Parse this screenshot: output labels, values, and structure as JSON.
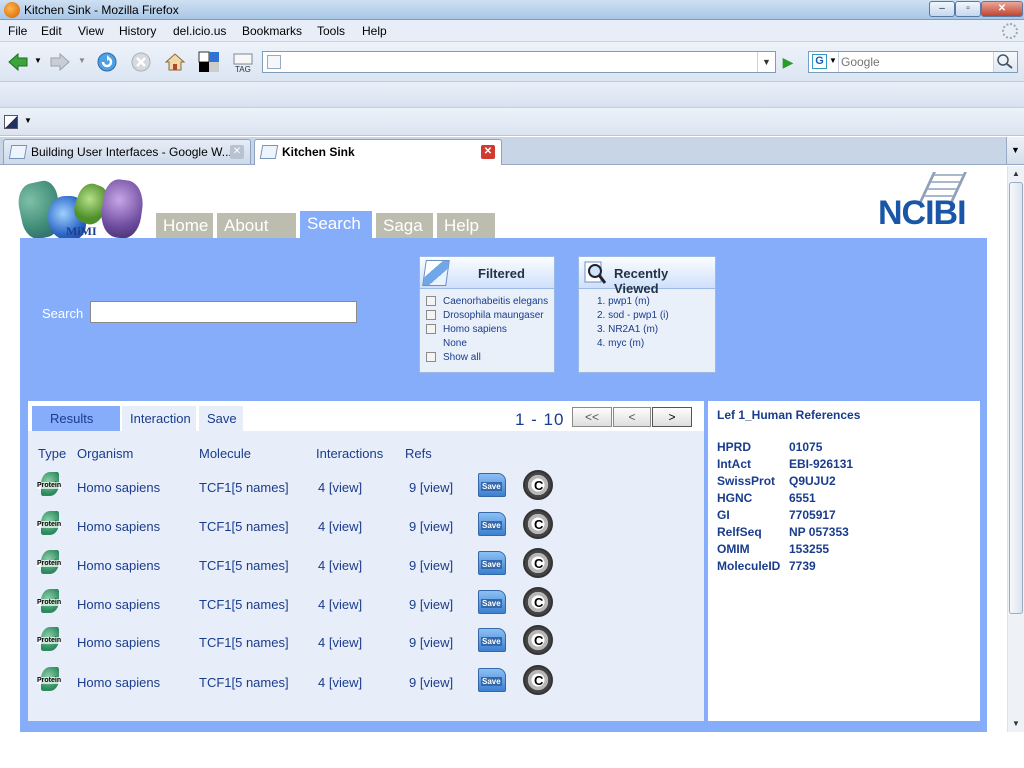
{
  "browser": {
    "window_title": "Kitchen Sink - Mozilla Firefox",
    "menu": [
      "File",
      "Edit",
      "View",
      "History",
      "del.icio.us",
      "Bookmarks",
      "Tools",
      "Help"
    ],
    "url": "",
    "search_engine_placeholder": "Google",
    "tabs": [
      {
        "label": "Building User Interfaces - Google W...",
        "active": false
      },
      {
        "label": "Kitchen Sink",
        "active": true
      }
    ],
    "nav_icons": [
      "back-icon",
      "forward-icon",
      "reload-icon",
      "stop-icon",
      "home-icon",
      "delicious-icon",
      "tag-icon"
    ]
  },
  "site": {
    "logo_left_text": "MiMI",
    "logo_right_text": "NCIBI",
    "nav_tabs": [
      "Home",
      "About",
      "Search",
      "Saga",
      "Help"
    ],
    "active_nav_tab": "Search",
    "search_label": "Search",
    "search_value": "",
    "filtered": {
      "title": "Filtered",
      "options": [
        "Caenorhabeitis elegans",
        "Drosophila maungaser",
        "Homo sapiens",
        "None",
        "Show all"
      ]
    },
    "recently_viewed": {
      "title": "Recently Viewed",
      "items": [
        "1. pwp1 (m)",
        "2. sod - pwp1 (i)",
        "3. NR2A1 (m)",
        "4. myc (m)"
      ]
    }
  },
  "results": {
    "tabs": [
      "Results",
      "Interaction",
      "Save"
    ],
    "active_tab": "Results",
    "pager": {
      "text": "1 - 10",
      "first": "<<",
      "prev": "<",
      "next": ">"
    },
    "columns": [
      "Type",
      "Organism",
      "Molecule",
      "Interactions",
      "Refs"
    ],
    "rows": [
      {
        "type": "Protein",
        "organism": "Homo sapiens",
        "molecule": "TCF1[5 names]",
        "interactions": "4 [view]",
        "refs": "9 [view]",
        "save": "Save"
      },
      {
        "type": "Protein",
        "organism": "Homo sapiens",
        "molecule": "TCF1[5 names]",
        "interactions": "4 [view]",
        "refs": "9 [view]",
        "save": "Save"
      },
      {
        "type": "Protein",
        "organism": "Homo sapiens",
        "molecule": "TCF1[5 names]",
        "interactions": "4 [view]",
        "refs": "9 [view]",
        "save": "Save"
      },
      {
        "type": "Protein",
        "organism": "Homo sapiens",
        "molecule": "TCF1[5 names]",
        "interactions": "4 [view]",
        "refs": "9 [view]",
        "save": "Save"
      },
      {
        "type": "Protein",
        "organism": "Homo sapiens",
        "molecule": "TCF1[5 names]",
        "interactions": "4 [view]",
        "refs": "9 [view]",
        "save": "Save"
      },
      {
        "type": "Protein",
        "organism": "Homo sapiens",
        "molecule": "TCF1[5 names]",
        "interactions": "4 [view]",
        "refs": "9 [view]",
        "save": "Save"
      }
    ]
  },
  "references": {
    "title": "Lef 1_Human References",
    "entries": [
      {
        "key": "HPRD",
        "value": "01075"
      },
      {
        "key": "IntAct",
        "value": "EBI-926131"
      },
      {
        "key": "SwissProt",
        "value": "Q9UJU2"
      },
      {
        "key": "HGNC",
        "value": "6551"
      },
      {
        "key": "GI",
        "value": "7705917"
      },
      {
        "key": "RelfSeq",
        "value": "NP 057353"
      },
      {
        "key": "OMIM",
        "value": "153255"
      },
      {
        "key": "MoleculeID",
        "value": "7739"
      }
    ]
  },
  "colors": {
    "accent_panel": "#86adf9",
    "nav_tab_inactive": "#bdbdaf",
    "text_link": "#1a3c8c"
  }
}
